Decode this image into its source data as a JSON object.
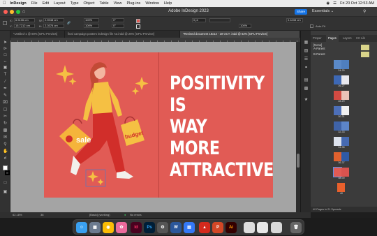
{
  "menubar": {
    "app": "InDesign",
    "items": [
      "File",
      "Edit",
      "Layout",
      "Type",
      "Object",
      "Table",
      "View",
      "Plug-ins",
      "Window",
      "Help"
    ],
    "clock": "Fri 20 Oct  12:53 AM"
  },
  "appbar": {
    "title": "Adobe InDesign 2023",
    "share": "Share",
    "workspace": "Essentials"
  },
  "control": {
    "x_value": "6.5106 cm",
    "y_value": "15.7212 cm",
    "w_value": "2.5948 cm",
    "h_value": "2.0376 cm",
    "scale_x": "100%",
    "scale_y": "100%",
    "angle": "0°",
    "shear": "0°",
    "stroke_pt": "0 pt",
    "zoom_pct": "100%",
    "gutter": "0.4233 cm",
    "autofit": "Auto-Fit"
  },
  "tabs": [
    "*Untitled-1 @ 69% [GPU Preview]",
    "final campaign posters indesign file A3.indd @ 26% [GPU Preview]",
    "*Revised document 18x14 - 19 OCT .indd @ 62% [GPU Preview]"
  ],
  "poster": {
    "lines": [
      "POSITIVITY",
      "IS",
      "WAY",
      "MORE",
      "ATTRACTIVE"
    ],
    "bag_left": "sale",
    "bag_right": "budget"
  },
  "pages_panel": {
    "tabs": [
      "Proper",
      "Pages",
      "Layers",
      "CC Lib"
    ],
    "parents": [
      "[None]",
      "A-Parent",
      "B-Parent"
    ],
    "spreads": [
      "24-25",
      "26-27",
      "28-29",
      "30-31",
      "32-33",
      "34-35",
      "36-37",
      "38-39",
      "40"
    ],
    "footer": "40 Pages in 21 Spreads"
  },
  "status": {
    "zoom": "62.18%",
    "page": "38",
    "style": "[Basic] (working)",
    "errors": "No errors"
  },
  "colors": {
    "poster_bg": "#e15b55",
    "accent_yellow": "#f5c043",
    "canvas": "#a4a4a4"
  }
}
